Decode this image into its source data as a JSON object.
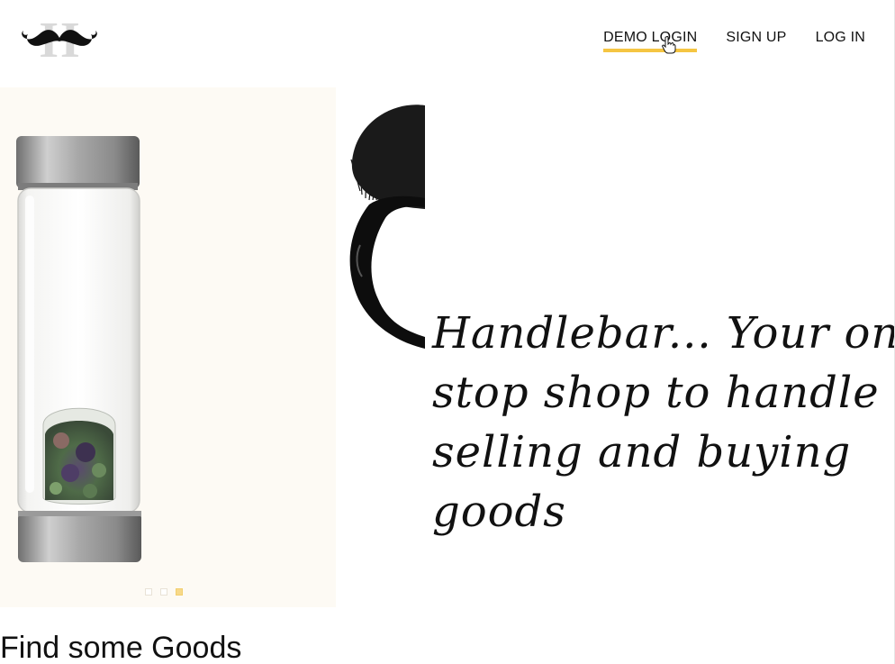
{
  "header": {
    "logo_icon": "mustache-logo-icon",
    "nav": [
      {
        "label": "DEMO LOGIN",
        "active": true
      },
      {
        "label": "SIGN UP",
        "active": false
      },
      {
        "label": "LOG IN",
        "active": false
      }
    ],
    "accent_color": "#f5c542"
  },
  "hero": {
    "tagline": "Handlebar... Your one stop shop to handle selling and buying goods",
    "carousel": {
      "slide_count": 3,
      "active_index": 2,
      "image_icon": "crystal-water-bottle-image",
      "dot_active_color": "#f7d98a"
    },
    "decor_icon": "mustache-glasses-image"
  },
  "section": {
    "title": "Find some Goods"
  }
}
